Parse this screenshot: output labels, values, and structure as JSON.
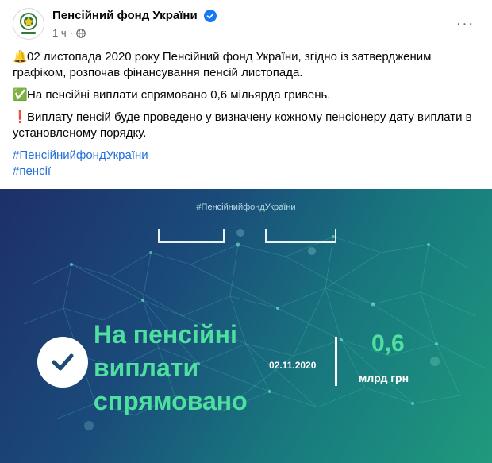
{
  "post": {
    "page_name": "Пенсійний фонд України",
    "timestamp": "1 ч",
    "dot": "·",
    "more_menu": "···",
    "paragraphs": [
      {
        "emoji": "🔔",
        "text": "02 листопада 2020 року Пенсійний фонд України, згідно із затвердженим графіком, розпочав фінансування пенсій листопада."
      },
      {
        "emoji": "✅",
        "text": "На пенсійні виплати спрямовано 0,6 мільярда гривень."
      },
      {
        "emoji": "❗",
        "text": "Виплату пенсій буде проведено у визначену кожному пенсіонеру дату виплати в установленому порядку."
      }
    ],
    "hashtags": [
      "#ПенсійнийфондУкраїни",
      "#пенсії"
    ]
  },
  "image": {
    "hashtag": "#ПенсійнийфондУкраїни",
    "headline_lines": [
      "На пенсійні",
      "виплати",
      "спрямовано"
    ],
    "date": "02.11.2020",
    "amount_value": "0,6",
    "amount_unit": "млрд грн"
  },
  "colors": {
    "link": "#216fdb",
    "verified": "#1877f2",
    "accent_green": "#4fe0a1",
    "image_bg_start": "#1e2f68",
    "image_bg_end": "#1f9a7d"
  },
  "icons": {
    "verified": "verified-badge-icon",
    "privacy": "globe-icon",
    "check": "check-icon",
    "more": "more-dots-icon"
  }
}
